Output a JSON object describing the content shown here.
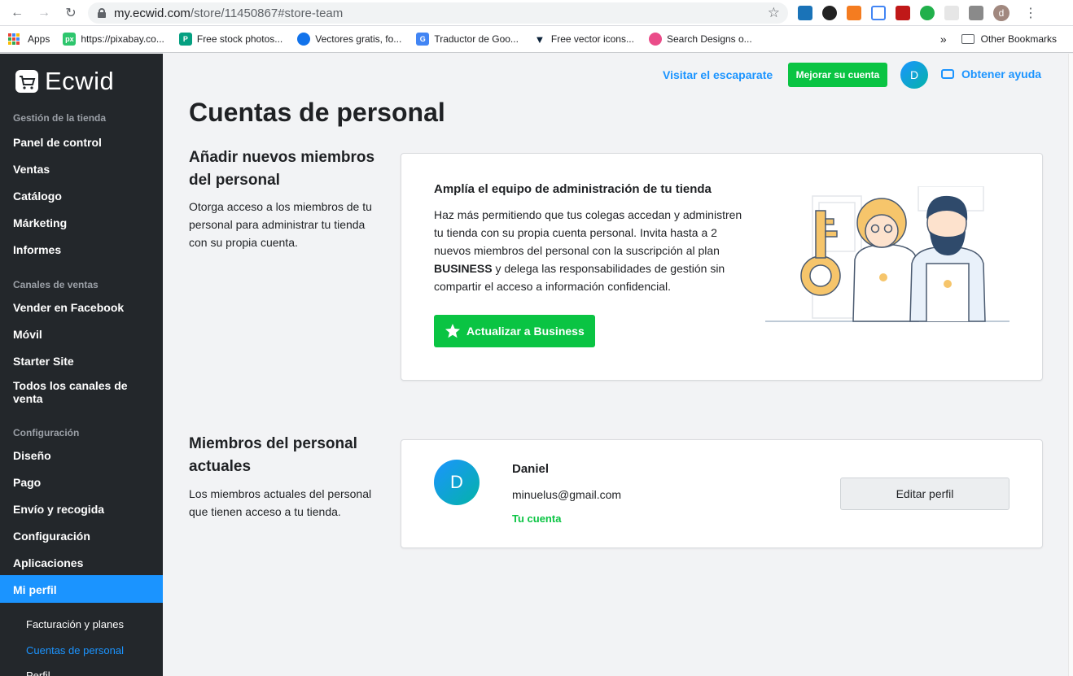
{
  "browser": {
    "url_host": "my.ecwid.com",
    "url_path": "/store/11450867#store-team",
    "profile_initial": "d",
    "bookmarks": [
      {
        "label": "Apps",
        "icon": "apps-grid-icon"
      },
      {
        "label": "https://pixabay.co...",
        "icon": "pixabay-icon",
        "color": "#2ec66d"
      },
      {
        "label": "Free stock photos...",
        "icon": "pexels-icon",
        "color": "#05a081"
      },
      {
        "label": "Vectores gratis, fo...",
        "icon": "freepik-icon",
        "color": "#1273eb"
      },
      {
        "label": "Traductor de Goo...",
        "icon": "google-translate-icon",
        "color": "#4285f4"
      },
      {
        "label": "Free vector icons...",
        "icon": "flaticon-icon",
        "color": "#0b2239"
      },
      {
        "label": "Search Designs o...",
        "icon": "dribbble-icon",
        "color": "#ea4c89"
      }
    ],
    "other_bookmarks": "Other Bookmarks",
    "overflow": "»"
  },
  "sidebar": {
    "brand": "Ecwid",
    "sections": [
      {
        "title": "Gestión de la tienda",
        "items": [
          "Panel de control",
          "Ventas",
          "Catálogo",
          "Márketing",
          "Informes"
        ]
      },
      {
        "title": "Canales de ventas",
        "items": [
          "Vender en Facebook",
          "Móvil",
          "Starter Site",
          "Todos los canales de venta"
        ]
      },
      {
        "title": "Configuración",
        "items": [
          "Diseño",
          "Pago",
          "Envío y recogida",
          "Configuración",
          "Aplicaciones",
          "Mi perfil"
        ]
      }
    ],
    "active_item": "Mi perfil",
    "sub_items": [
      "Facturación y planes",
      "Cuentas de personal",
      "Perfil"
    ],
    "active_sub_item": "Cuentas de personal"
  },
  "topbar": {
    "storefront_link": "Visitar el escaparate",
    "upgrade_button": "Mejorar su cuenta",
    "avatar_initial": "D",
    "help_link": "Obtener ayuda"
  },
  "page": {
    "title": "Cuentas de personal",
    "add_section": {
      "heading": "Añadir nuevos miembros del personal",
      "description": "Otorga acceso a los miembros de tu personal para administrar tu tienda con su propia cuenta.",
      "card_title": "Amplía el equipo de administración de tu tienda",
      "card_text_before": "Haz más permitiendo que tus colegas accedan y administren tu tienda con su propia cuenta personal. Invita hasta a 2 nuevos miembros del personal con la suscripción al plan ",
      "card_text_bold": "BUSINESS",
      "card_text_after": " y delega las responsabilidades de gestión sin compartir el acceso a información confidencial.",
      "cta_button": "Actualizar a Business"
    },
    "members_section": {
      "heading": "Miembros del personal actuales",
      "description": "Los miembros actuales del personal que tienen acceso a tu tienda.",
      "members": [
        {
          "initial": "D",
          "name": "Daniel",
          "email": "minuelus@gmail.com",
          "tag": "Tu cuenta",
          "action": "Editar perfil"
        }
      ]
    }
  },
  "colors": {
    "accent": "#1b94ff",
    "success": "#0ac443",
    "sidebar_bg": "#23272b"
  }
}
